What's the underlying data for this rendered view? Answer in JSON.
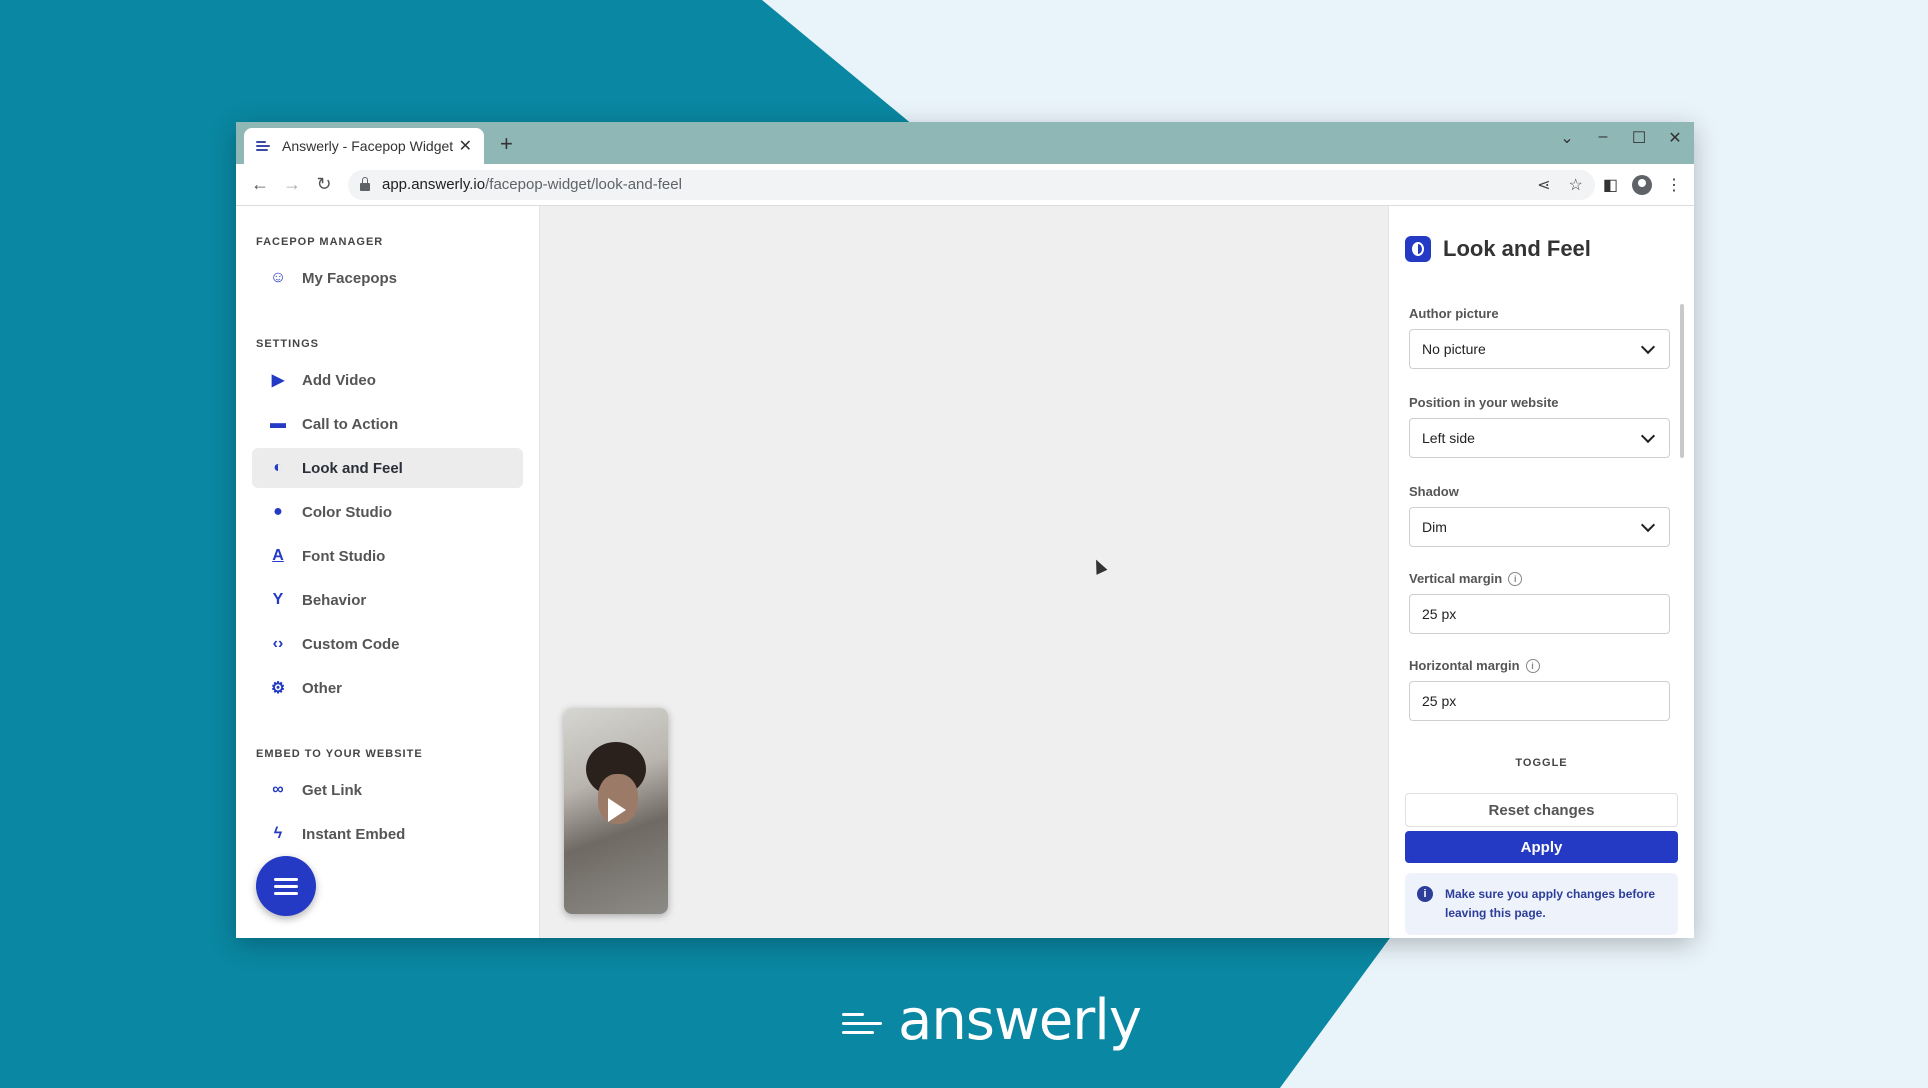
{
  "colors": {
    "teal": "#0a87a2",
    "light_bg": "#e9f4fa",
    "accent": "#2439c4"
  },
  "browser": {
    "tab_title": "Answerly - Facepop Widget",
    "tab_close": "✕",
    "new_tab": "+",
    "url_host": "app.answerly.io",
    "url_path": "/facepop-widget/look-and-feel"
  },
  "sidebar": {
    "section_manager": "FACEPOP MANAGER",
    "my_facepops": "My Facepops",
    "section_settings": "SETTINGS",
    "settings_items": [
      {
        "label": "Add Video",
        "icon": "play-box-icon"
      },
      {
        "label": "Call to Action",
        "icon": "window-icon"
      },
      {
        "label": "Look and Feel",
        "icon": "contrast-icon"
      },
      {
        "label": "Color Studio",
        "icon": "palette-icon"
      },
      {
        "label": "Font Studio",
        "icon": "font-icon"
      },
      {
        "label": "Behavior",
        "icon": "branch-icon"
      },
      {
        "label": "Custom Code",
        "icon": "code-icon"
      },
      {
        "label": "Other",
        "icon": "gear-icon"
      }
    ],
    "section_embed": "EMBED TO YOUR WEBSITE",
    "embed_items": [
      {
        "label": "Get Link",
        "icon": "link-icon"
      },
      {
        "label": "Instant Embed",
        "icon": "bolt-icon"
      }
    ]
  },
  "panel": {
    "title": "Look and Feel",
    "author_picture_label": "Author picture",
    "author_picture_value": "No picture",
    "position_label": "Position in your website",
    "position_value": "Left side",
    "shadow_label": "Shadow",
    "shadow_value": "Dim",
    "vertical_margin_label": "Vertical margin",
    "vertical_margin_value": "25 px",
    "horizontal_margin_label": "Horizontal margin",
    "horizontal_margin_value": "25 px",
    "toggle_label": "TOGGLE",
    "reset_label": "Reset changes",
    "apply_label": "Apply",
    "notice": "Make sure you apply changes before leaving this page."
  },
  "logo": {
    "text": "answerly"
  }
}
